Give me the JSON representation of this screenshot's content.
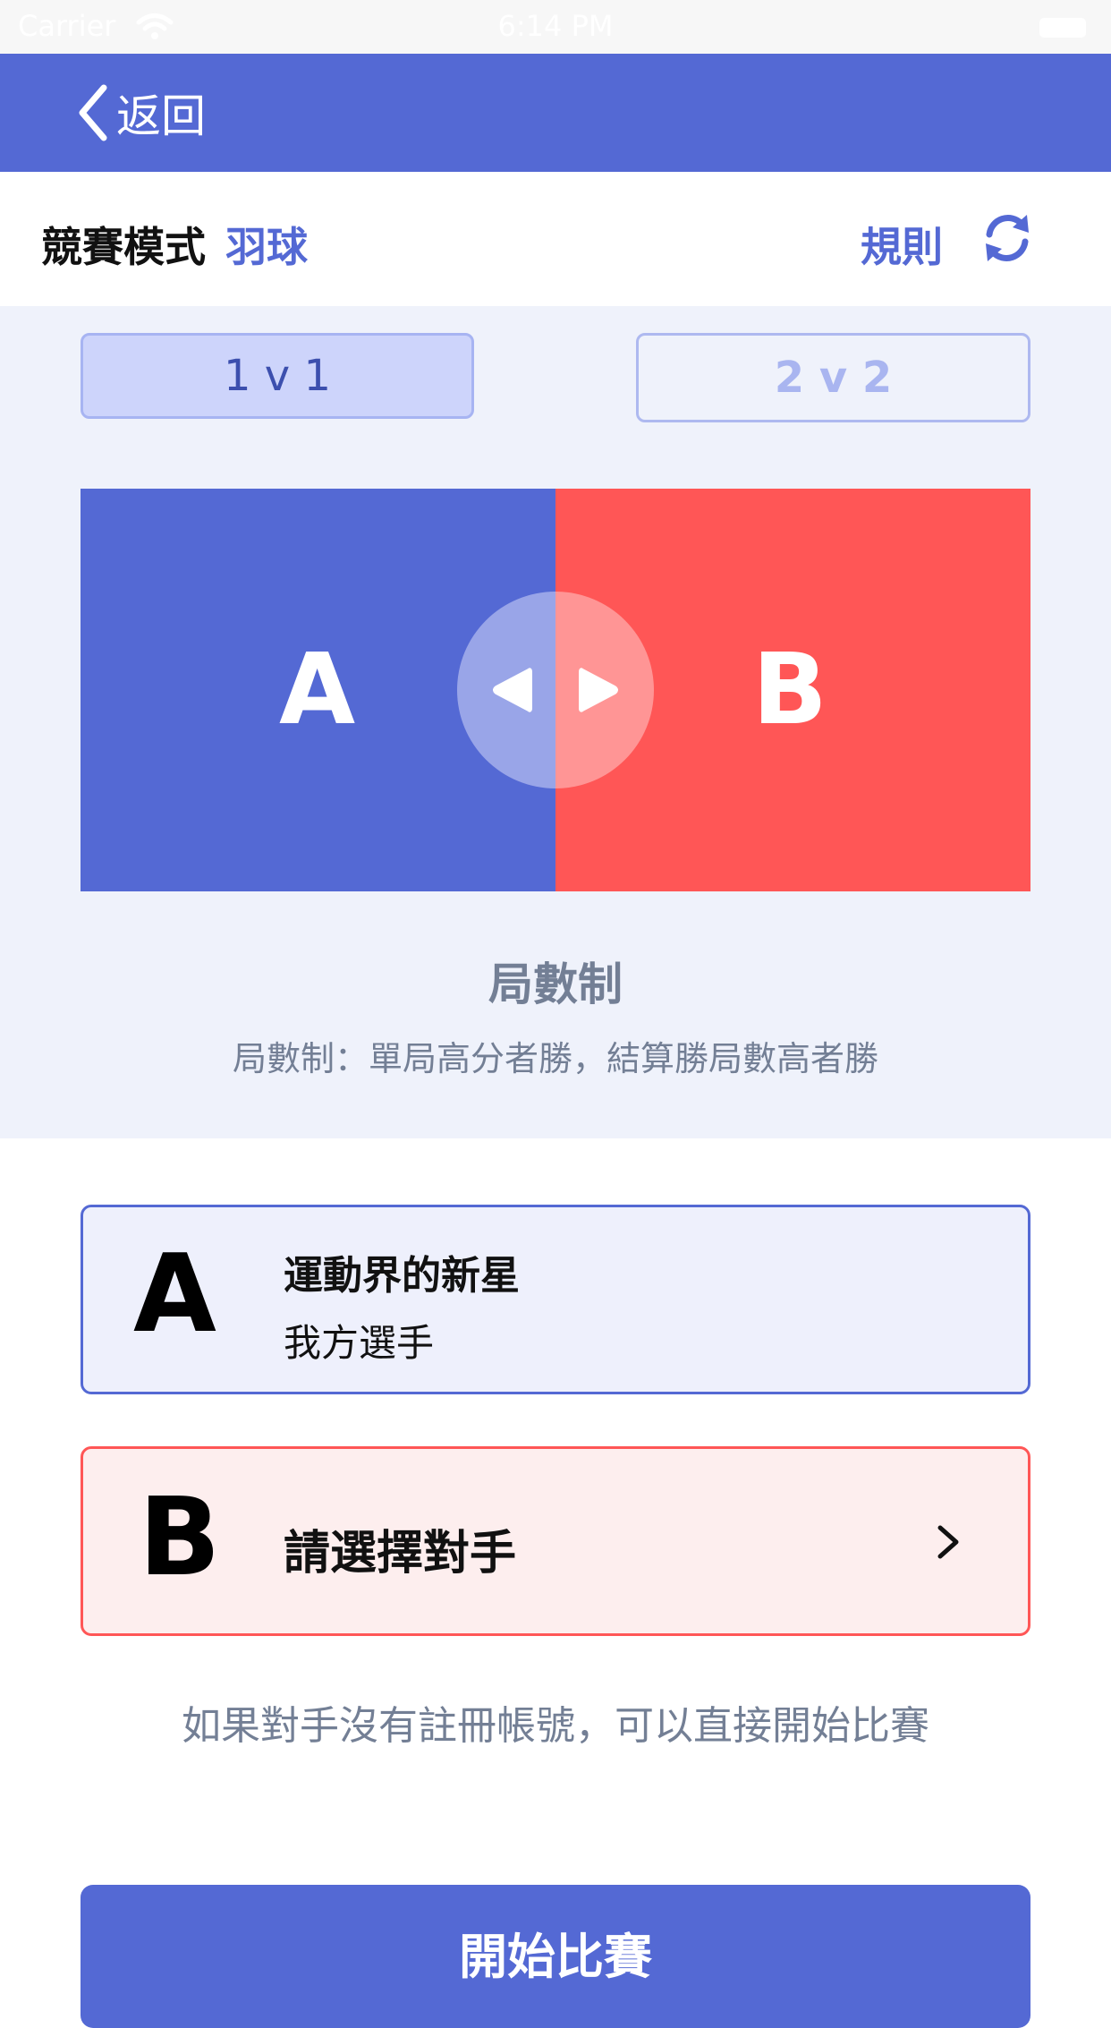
{
  "status_bar": {
    "carrier": "Carrier",
    "time": "6:14 PM"
  },
  "nav": {
    "back_label": "返回"
  },
  "header": {
    "mode_title": "競賽模式",
    "sport": "羽球",
    "rules_label": "規則"
  },
  "modes": {
    "one_v_one": "1 v 1",
    "two_v_two": "2  v  2",
    "selected": "1 v 1"
  },
  "court": {
    "side_a": "A",
    "side_b": "B"
  },
  "scoring": {
    "title": "局數制",
    "description": "局數制：單局高分者勝，結算勝局數高者勝"
  },
  "players": {
    "a": {
      "letter": "A",
      "name": "運動界的新星",
      "role": "我方選手"
    },
    "b": {
      "letter": "B",
      "prompt": "請選擇對手"
    }
  },
  "hint": "如果對手沒有註冊帳號，可以直接開始比賽",
  "start_button": "開始比賽",
  "colors": {
    "primary": "#5469d4",
    "opponent": "#ff5656",
    "panel_bg": "#eff2fb",
    "muted_text": "#737f95"
  },
  "icons": [
    "wifi-icon",
    "battery-icon",
    "chevron-left-icon",
    "refresh-icon",
    "swap-left-arrow-icon",
    "swap-right-arrow-icon",
    "chevron-right-icon"
  ]
}
